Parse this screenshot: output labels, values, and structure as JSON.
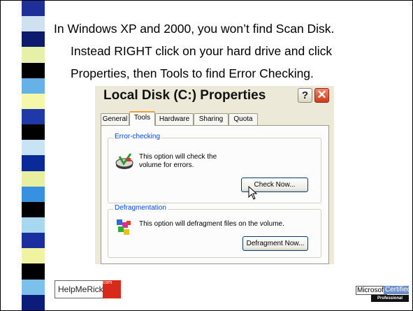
{
  "slide": {
    "lines": [
      "In Windows XP and 2000, you won’t find Scan Disk.",
      "Instead RIGHT click on your hard drive and click",
      "Properties, then Tools to find Error Checking."
    ]
  },
  "dialog": {
    "title": "Local Disk (C:) Properties",
    "help_button": "?",
    "close_button": "✕",
    "tabs": [
      "General",
      "Tools",
      "Hardware",
      "Sharing",
      "Quota"
    ],
    "active_tab": "Tools",
    "error_checking": {
      "label": "Error-checking",
      "description": "This option will check the volume for errors.",
      "button": "Check Now..."
    },
    "defragmentation": {
      "label": "Defragmentation",
      "description": "This option will defragment files on the volume.",
      "button": "Defragment Now..."
    }
  },
  "logos": {
    "left_text": "HelpMeRick",
    "left_badge": "com",
    "ms_text": "Microsoft",
    "certified": "Certified",
    "professional": "Professional"
  },
  "stripe_colors": [
    "#1f2f9a",
    "#cfe0ef",
    "#0d1a6e",
    "#e6f0a8",
    "#000000",
    "#66b2e8",
    "#f4f8a8",
    "#1f3aa8",
    "#000000",
    "#c8e4f4",
    "#0a2a9a",
    "#e8f0a0",
    "#3890e0",
    "#000000",
    "#a8d8f0",
    "#1a2f9f",
    "#f0f4a0",
    "#000000",
    "#7cc0ec",
    "#0c1c7a"
  ]
}
